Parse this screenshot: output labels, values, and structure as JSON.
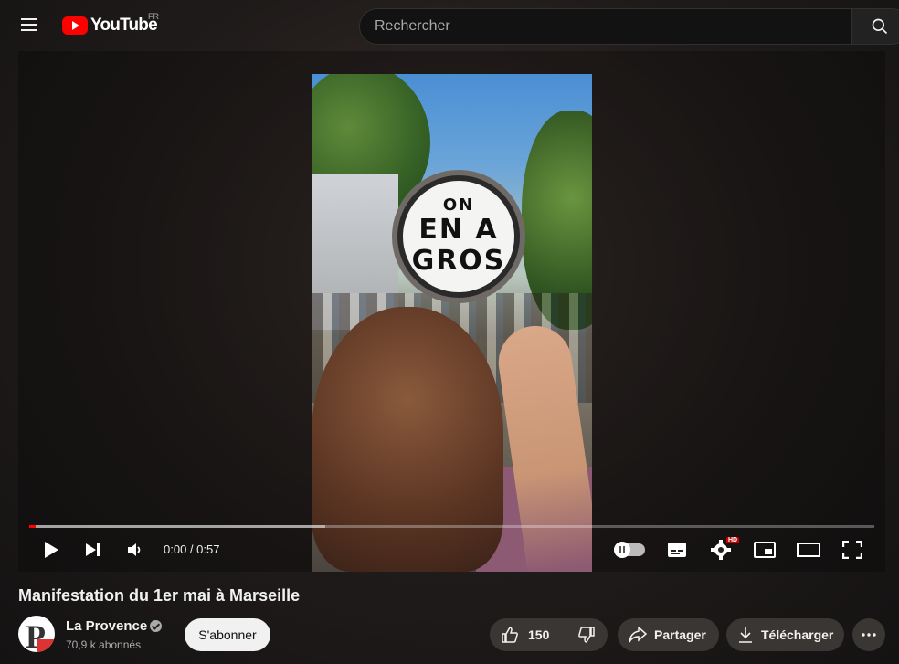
{
  "header": {
    "logo_text": "YouTube",
    "country_code": "FR",
    "search_placeholder": "Rechercher"
  },
  "player": {
    "sign_lines": [
      "ON",
      "EN A",
      "GROS"
    ],
    "time_display": "0:00 / 0:57",
    "progress_played_fraction": 0.008,
    "progress_loaded_fraction": 0.35,
    "hd_badge": "HD",
    "accent_color": "#ff0000"
  },
  "video": {
    "title": "Manifestation du 1er mai à Marseille"
  },
  "channel": {
    "name": "La Provence",
    "subscribers": "70,9 k abonnés",
    "avatar_letter": "P",
    "subscribe_label": "S'abonner"
  },
  "actions": {
    "like_count": "150",
    "share_label": "Partager",
    "download_label": "Télécharger"
  },
  "icons": [
    "menu-icon",
    "youtube-logo-icon",
    "search-icon",
    "play-icon",
    "next-icon",
    "volume-icon",
    "autoplay-toggle-icon",
    "subtitles-icon",
    "settings-icon",
    "miniplayer-icon",
    "theater-icon",
    "fullscreen-icon",
    "verified-icon",
    "like-icon",
    "dislike-icon",
    "share-icon",
    "download-icon",
    "more-icon"
  ]
}
